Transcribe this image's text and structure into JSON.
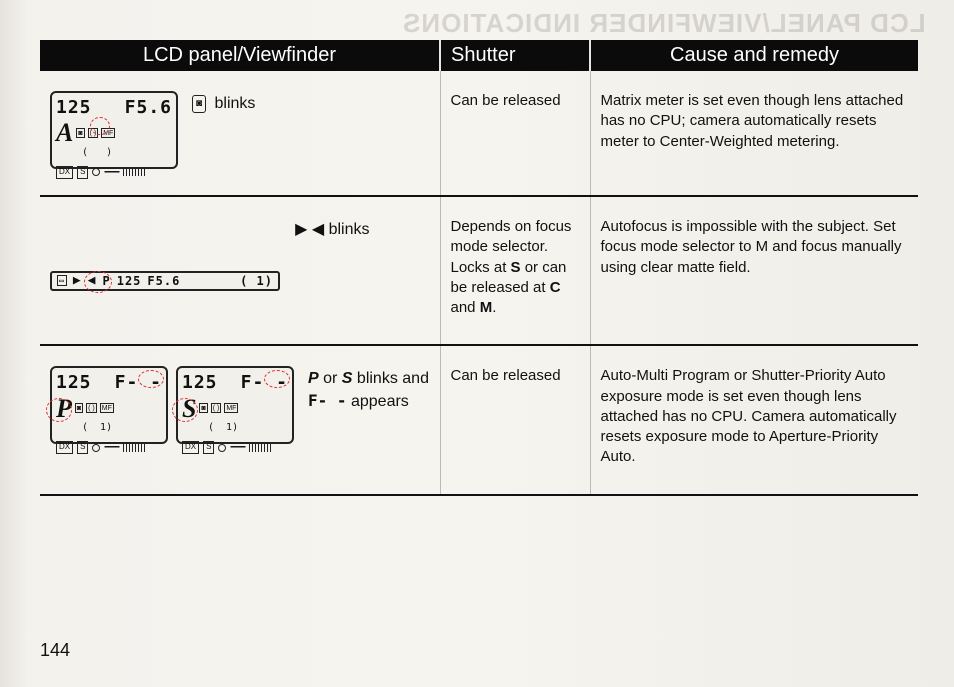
{
  "ghost_header": "LCD PANEL/VIEWFINDER INDICATIONS",
  "headers": {
    "lcd": "LCD panel/Viewfinder",
    "shutter": "Shutter",
    "cause": "Cause and remedy"
  },
  "rows": [
    {
      "lcd_values": {
        "shutter_speed": "125",
        "aperture": "F5.6",
        "mode": "A"
      },
      "lcd_desc_html": "<span class='meter-icon'>◙</span> blinks",
      "shutter_html": "Can be released",
      "cause_html": "Matrix meter is set even though lens attached has no CPU; camera automatically resets meter to Center-Weighted metering."
    },
    {
      "vf_values": {
        "mode": "P",
        "shutter_speed": "125",
        "aperture": "F5.6",
        "brackets": "(   1)"
      },
      "lcd_desc_html": "▶  ◀ blinks",
      "shutter_html": "Depends on focus mode selector. Locks at <b>S</b> or can be released at <b>C</b> and <b>M</b>.",
      "cause_html": "Autofocus is impossible with the subject. Set focus mode selector to M and focus manually using clear matte field."
    },
    {
      "lcd_pair": [
        {
          "shutter_speed": "125",
          "aperture": "F- -",
          "mode": "P"
        },
        {
          "shutter_speed": "125",
          "aperture": "F- -",
          "mode": "S"
        }
      ],
      "lcd_desc_html": "<i><b>P</b></i> or <i><b>S</b></i> blinks and <span style='font-family:monospace;font-weight:bold'>F- -</span> appears",
      "shutter_html": "Can be released",
      "cause_html": "Auto-Multi Program or Shutter-Priority Auto exposure mode is set even though lens attached has no CPU. Camera automatically resets exposure mode to Aperture-Priority Auto."
    }
  ],
  "page_number": "144"
}
